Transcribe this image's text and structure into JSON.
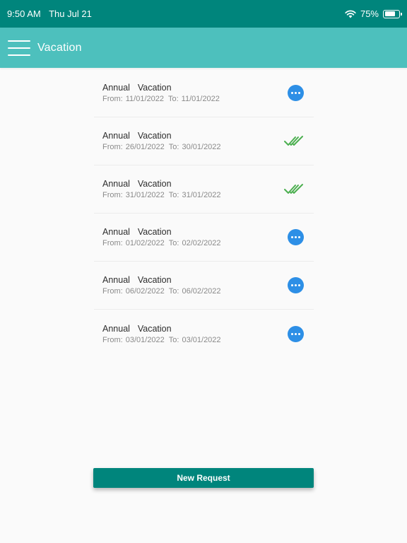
{
  "status_bar": {
    "time": "9:50 AM",
    "date": "Thu Jul 21",
    "battery_text": "75%",
    "battery_level": 0.75
  },
  "app_bar": {
    "title": "Vacation",
    "menu_icon": "hamburger-menu-icon"
  },
  "colors": {
    "status_bar_bg": "#00857c",
    "app_bar_bg": "#4dc0bd",
    "pending": "#2d8fe6",
    "approved": "#4caf50",
    "button_bg": "#00857c"
  },
  "vacations": [
    {
      "type": "Annual  Vacation",
      "from_label": "From:",
      "from": "11/01/2022",
      "to_label": "To:",
      "to": "11/01/2022",
      "status": "pending"
    },
    {
      "type": "Annual  Vacation",
      "from_label": "From:",
      "from": "26/01/2022",
      "to_label": "To:",
      "to": "30/01/2022",
      "status": "approved"
    },
    {
      "type": "Annual  Vacation",
      "from_label": "From:",
      "from": "31/01/2022",
      "to_label": "To:",
      "to": "31/01/2022",
      "status": "approved"
    },
    {
      "type": "Annual  Vacation",
      "from_label": "From:",
      "from": "01/02/2022",
      "to_label": "To:",
      "to": "02/02/2022",
      "status": "pending"
    },
    {
      "type": "Annual  Vacation",
      "from_label": "From:",
      "from": "06/02/2022",
      "to_label": "To:",
      "to": "06/02/2022",
      "status": "pending"
    },
    {
      "type": "Annual  Vacation",
      "from_label": "From:",
      "from": "03/01/2022",
      "to_label": "To:",
      "to": "03/01/2022",
      "status": "pending"
    }
  ],
  "new_request_label": "New Request"
}
